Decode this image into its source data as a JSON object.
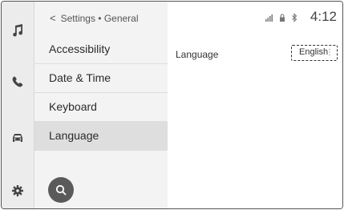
{
  "rail": {
    "icons": [
      "music-icon",
      "phone-icon",
      "car-icon",
      "gear-icon"
    ]
  },
  "breadcrumb": {
    "back_glyph": "<",
    "path": "Settings • General"
  },
  "menu": {
    "items": [
      {
        "label": "Accessibility"
      },
      {
        "label": "Date & Time"
      },
      {
        "label": "Keyboard"
      },
      {
        "label": "Language",
        "selected": true
      }
    ]
  },
  "status": {
    "time": "4:12",
    "icons": [
      "signal-icon",
      "lock-icon",
      "bluetooth-icon"
    ]
  },
  "detail": {
    "language_label": "Language",
    "language_value": "English",
    "more_glyph": "⋮"
  },
  "search": {
    "icon": "search-icon"
  },
  "colors": {
    "rail_bg": "#ececec",
    "menu_bg": "#f3f3f3",
    "selected_bg": "#dedede",
    "search_button": "#5a5a5a"
  }
}
